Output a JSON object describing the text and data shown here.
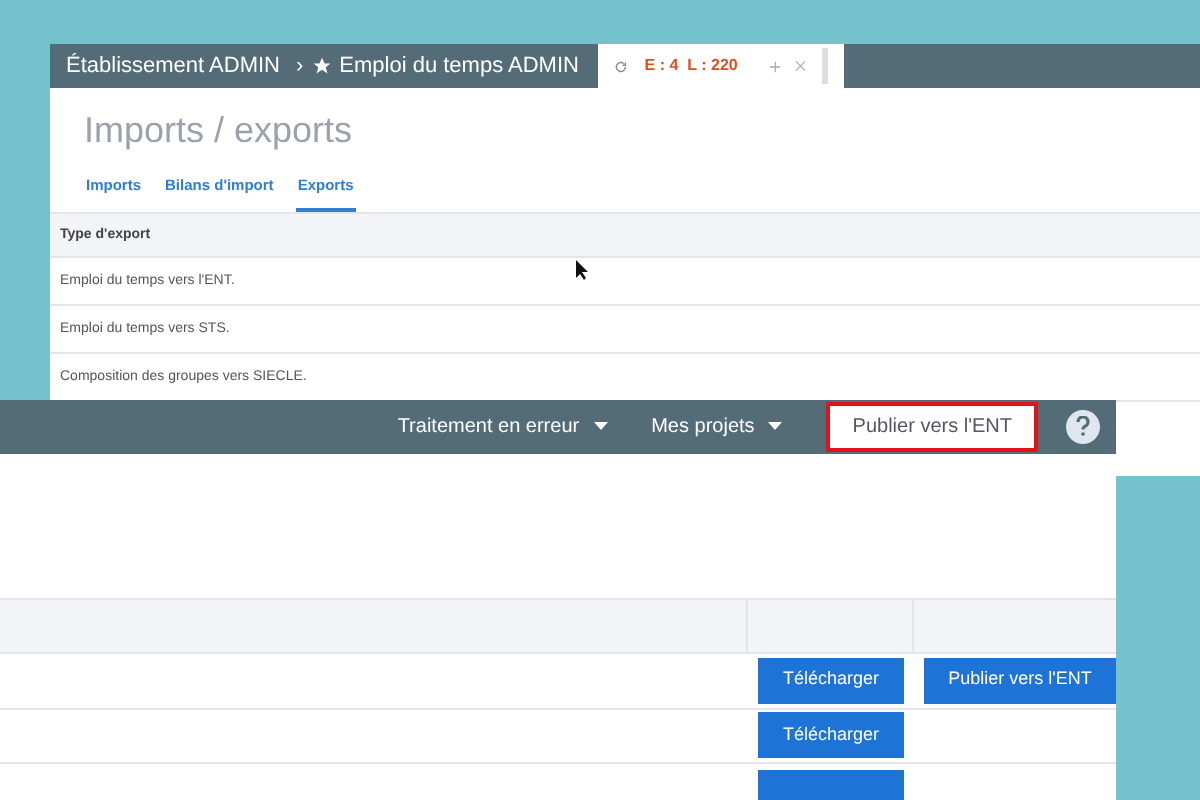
{
  "back_window": {
    "breadcrumb": [
      "Établissement ADMIN",
      "›",
      "Emploi du temps ADMIN"
    ],
    "tab_counter": "E : 4  L : 220",
    "page_title": "Imports / exports",
    "tabs": [
      {
        "label": "Imports",
        "selected": false
      },
      {
        "label": "Bilans d'import",
        "selected": false
      },
      {
        "label": "Exports",
        "selected": true
      }
    ],
    "table": {
      "columns": [
        "Type d'export"
      ],
      "rows": [
        "Emploi du temps vers l'ENT.",
        "Emploi du temps vers STS.",
        "Composition des groupes vers SIECLE."
      ]
    }
  },
  "front_window": {
    "menu": [
      {
        "label": "Traitement en erreur",
        "kind": "dropdown",
        "highlighted": false
      },
      {
        "label": "Mes projets",
        "kind": "dropdown",
        "highlighted": false
      },
      {
        "label": "Publier vers l'ENT",
        "kind": "link",
        "highlighted": true
      }
    ],
    "rows": [
      {
        "buttons": [
          "Télécharger",
          "Publier vers l'ENT"
        ]
      },
      {
        "buttons": [
          "Télécharger"
        ]
      }
    ]
  }
}
